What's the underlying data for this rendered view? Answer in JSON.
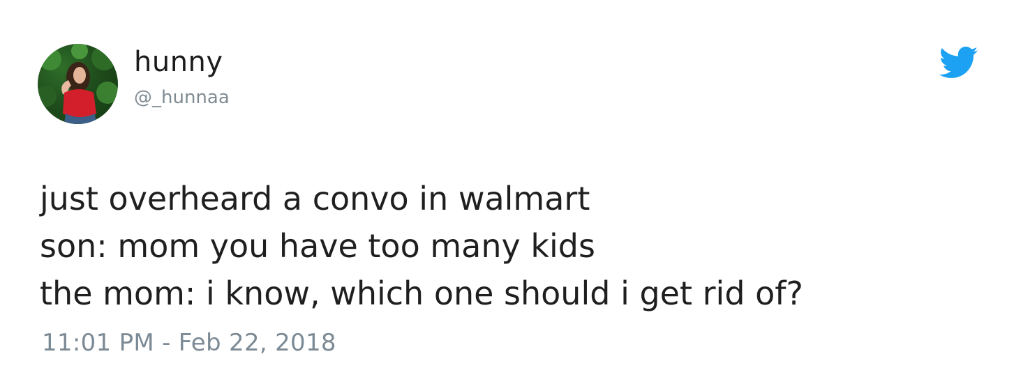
{
  "author": {
    "display_name": "hunny",
    "handle": "@_hunnaa",
    "avatar_icon": "profile-avatar"
  },
  "brand": {
    "icon": "twitter-bird-icon",
    "color": "#1da1f2"
  },
  "tweet": {
    "lines": [
      "just overheard a convo in walmart",
      "son: mom you have too many kids",
      "the mom: i know, which one should i get rid of?"
    ],
    "timestamp": "11:01 PM - Feb 22, 2018"
  }
}
